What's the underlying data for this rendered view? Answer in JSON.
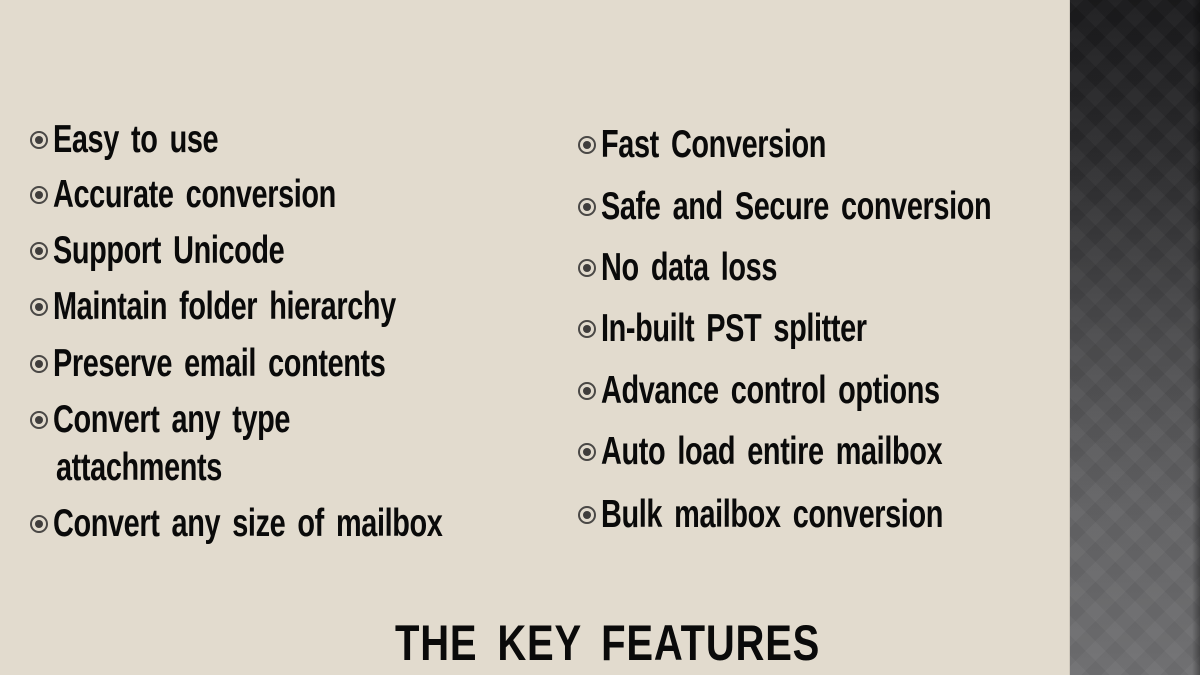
{
  "slide": {
    "title": "THE KEY FEATURES",
    "bullet_icon": "radio-bullet-icon",
    "colors": {
      "background": "#e2dbce",
      "text": "#0a0a0a",
      "side_panel_top": "#19191b",
      "side_panel_bottom": "#6f6f71"
    },
    "left_column": [
      {
        "label": "Easy to use"
      },
      {
        "label": "Accurate conversion"
      },
      {
        "label": "Support Unicode"
      },
      {
        "label": "Maintain folder hierarchy"
      },
      {
        "label": "Preserve email contents"
      },
      {
        "label": "Convert any type",
        "continuation": "attachments"
      },
      {
        "label": "Convert any size of mailbox"
      }
    ],
    "right_column": [
      {
        "label": "Fast Conversion"
      },
      {
        "label": "Safe and Secure conversion"
      },
      {
        "label": "No data loss"
      },
      {
        "label": "In-built PST splitter"
      },
      {
        "label": "Advance control options"
      },
      {
        "label": "Auto load entire mailbox"
      },
      {
        "label": "Bulk mailbox conversion"
      }
    ]
  }
}
